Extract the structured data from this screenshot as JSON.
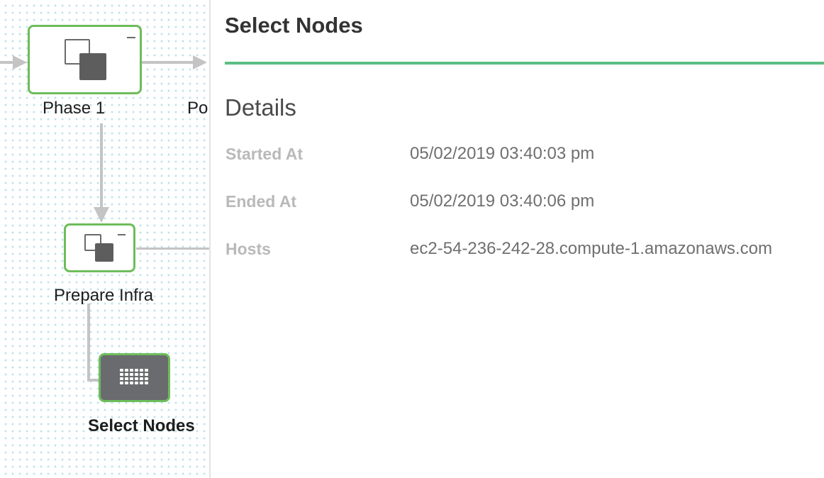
{
  "canvas": {
    "nodes": [
      {
        "label": "Phase 1",
        "icon": "phase-icon"
      },
      {
        "label": "Po",
        "icon": null
      },
      {
        "label": "Prepare Infra",
        "icon": "phase-icon"
      },
      {
        "label": "Select Nodes",
        "icon": "grid-icon"
      }
    ]
  },
  "panel": {
    "title": "Select Nodes",
    "section_title": "Details",
    "details": [
      {
        "label": "Started At",
        "value": "05/02/2019 03:40:03 pm"
      },
      {
        "label": "Ended At",
        "value": "05/02/2019 03:40:06 pm"
      },
      {
        "label": "Hosts",
        "value": "ec2-54-236-242-28.compute-1.amazonaws.com"
      }
    ]
  },
  "colors": {
    "node_border": "#6dbd5a",
    "accent_divider": "#5cbf85",
    "selected_node_fill": "#6a6b6e"
  }
}
